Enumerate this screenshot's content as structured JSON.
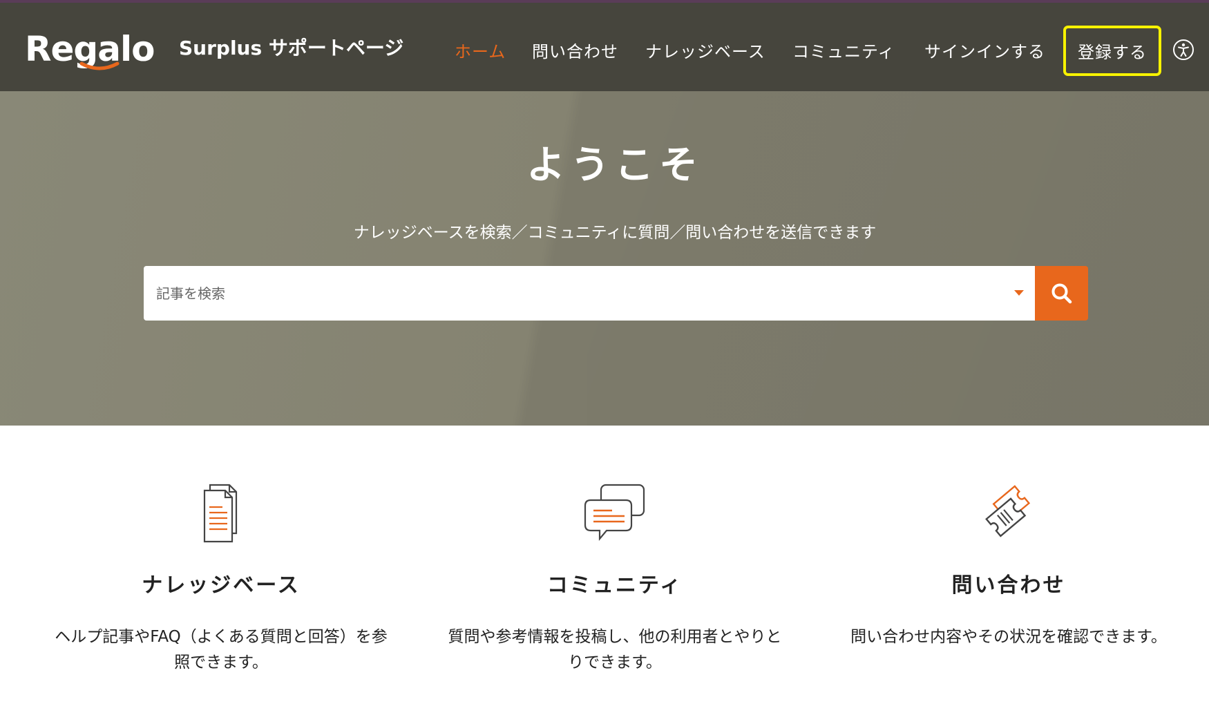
{
  "brand": {
    "logo_text": "Regalo",
    "site_title": "Surplus サポートページ"
  },
  "nav": {
    "home": "ホーム",
    "contact": "問い合わせ",
    "knowledge_base": "ナレッジベース",
    "community": "コミュニティ",
    "sign_in": "サインインする",
    "register": "登録する"
  },
  "hero": {
    "title": "ようこそ",
    "subtitle": "ナレッジベースを検索／コミュニティに質問／問い合わせを送信できます",
    "search": {
      "placeholder": "記事を検索",
      "value": ""
    }
  },
  "features": [
    {
      "icon": "document-icon",
      "title": "ナレッジベース",
      "description": "ヘルプ記事やFAQ（よくある質問と回答）を参照できます。"
    },
    {
      "icon": "chat-bubbles-icon",
      "title": "コミュニティ",
      "description": "質問や参考情報を投稿し、他の利用者とやりとりできます。"
    },
    {
      "icon": "ticket-icon",
      "title": "問い合わせ",
      "description": "問い合わせ内容やその状況を確認できます。"
    }
  ],
  "colors": {
    "accent": "#e8671c",
    "header_bg": "#46453d",
    "hero_bg": "#838170",
    "focus_outline": "#f7f200"
  }
}
